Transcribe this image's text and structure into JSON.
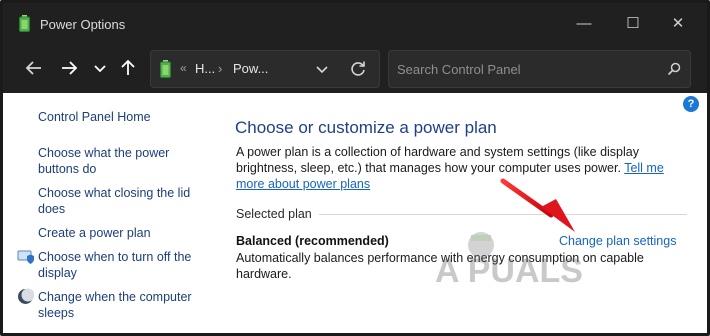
{
  "window": {
    "title": "Power Options",
    "buttons": [
      "—",
      "☐",
      "✕"
    ]
  },
  "address_bar": {
    "separator": "«",
    "crumbs": [
      "H...",
      "Pow..."
    ],
    "chevron": "›"
  },
  "search": {
    "placeholder": "Search Control Panel"
  },
  "left_pane": {
    "links": [
      "Control Panel Home",
      "Choose what the power buttons do",
      "Choose what closing the lid does",
      "Create a power plan",
      "Choose when to turn off the display",
      "Change when the computer sleeps"
    ]
  },
  "main": {
    "help": "?",
    "heading": "Choose or customize a power plan",
    "description": "A power plan is a collection of hardware and system settings (like display brightness, sleep, etc.) that manages how your computer uses power.",
    "more_link": "Tell me more about power plans",
    "selected_label": "Selected plan",
    "plan_name": "Balanced (recommended)",
    "plan_description": "Automatically balances performance with energy consumption on capable hardware.",
    "change_link": "Change plan settings"
  },
  "watermark": "A PUALS",
  "colors": {
    "titlebar": "#202020",
    "link": "#1565c0",
    "heading": "#1e3f8a",
    "arrow": "#e0141c"
  }
}
